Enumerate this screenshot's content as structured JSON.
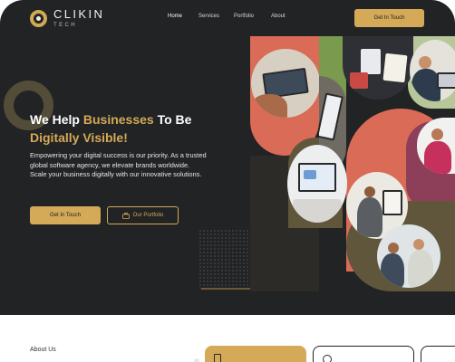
{
  "brand": {
    "name": "CLIKIN",
    "sub": "TECH"
  },
  "nav": {
    "items": [
      "Home",
      "Services",
      "Portfolio",
      "About"
    ],
    "cta_label": "Get In Touch"
  },
  "hero": {
    "headline_1": "We Help ",
    "headline_highlight_1": "Businesses",
    "headline_2": " To Be",
    "headline_highlight_2": "Digitally Visible!",
    "description": "Empowering your digital success is our priority. As a trusted global software agency, we elevate brands worldwide. Scale your business digitally with our innovative solutions.",
    "primary_button": "Get In Touch",
    "secondary_button": "Our Portfolio"
  },
  "about": {
    "label": "About Us"
  },
  "colors": {
    "accent": "#d4a957",
    "background": "#222325",
    "coral": "#d96b57",
    "olive": "#5f563c",
    "sage": "#7a9a4e",
    "plum": "#8d3f5a"
  }
}
